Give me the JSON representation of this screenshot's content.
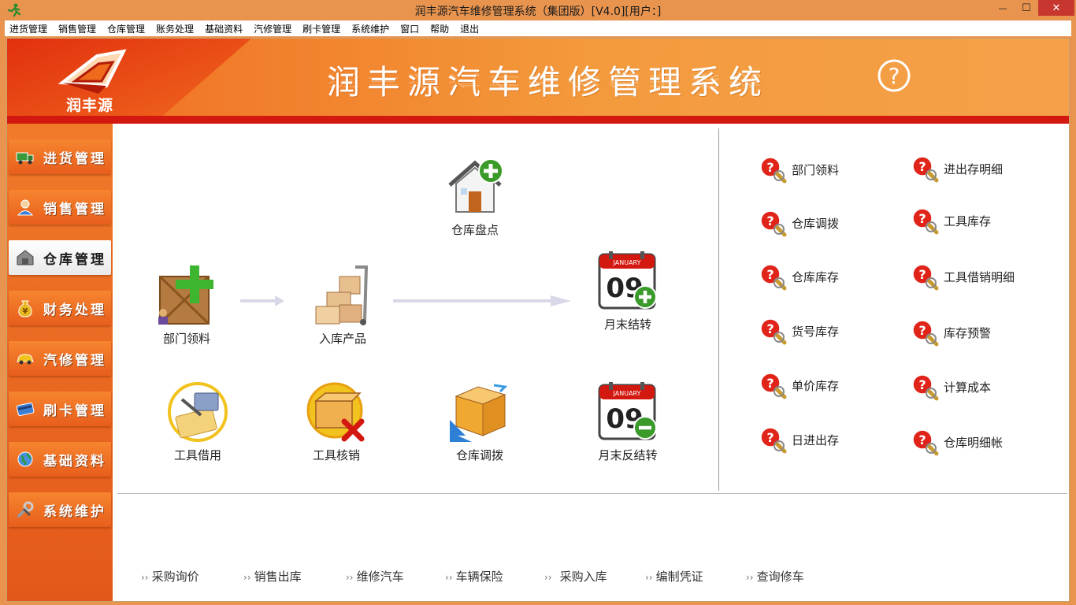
{
  "window": {
    "title": "润丰源汽车维修管理系统（集团版）[V4.0][用户：]",
    "minimize_glyph": "—",
    "maximize_glyph": "☐",
    "close_glyph": "✕"
  },
  "menubar": {
    "items": [
      "进货管理",
      "销售管理",
      "仓库管理",
      "账务处理",
      "基础资料",
      "汽修管理",
      "刷卡管理",
      "系统维护",
      "窗口",
      "帮助",
      "退出"
    ]
  },
  "banner": {
    "logo_text": "润丰源",
    "title": "润丰源汽车维修管理系统",
    "help_glyph": "?"
  },
  "leftnav": {
    "items": [
      {
        "label": "进货管理",
        "icon": "truck-icon"
      },
      {
        "label": "销售管理",
        "icon": "sales-person-icon"
      },
      {
        "label": "仓库管理",
        "icon": "warehouse-icon"
      },
      {
        "label": "财务处理",
        "icon": "money-bag-icon"
      },
      {
        "label": "汽修管理",
        "icon": "car-icon"
      },
      {
        "label": "刷卡管理",
        "icon": "card-icon"
      },
      {
        "label": "基础资料",
        "icon": "globe-icon"
      },
      {
        "label": "系统维护",
        "icon": "tools-icon"
      }
    ],
    "active_index": 2
  },
  "flow": {
    "warehouse_check": "仓库盘点",
    "dept_material": "部门领料",
    "inbound_product": "入库产品",
    "month_close": "月末结转",
    "tool_borrow": "工具借用",
    "tool_writeoff": "工具核销",
    "warehouse_transfer": "仓库调拨",
    "month_reopen": "月末反结转",
    "calendar_month": "JANUARY",
    "calendar_day": "09"
  },
  "queries": {
    "left": [
      "部门领料",
      "仓库调拨",
      "仓库库存",
      "货号库存",
      "单价库存",
      "日进出存"
    ],
    "right": [
      "进出存明细",
      "工具库存",
      "工具借销明细",
      "库存预警",
      "计算成本",
      "仓库明细帐"
    ]
  },
  "quick_links": [
    "采购询价",
    "销售出库",
    "维修汽车",
    "车辆保险",
    "采购入库",
    "编制凭证",
    "查询修车"
  ],
  "quick_link_chevron": "››",
  "colors": {
    "banner_orange": "#F06A1E",
    "banner_red": "#D3180F",
    "nav_orange": "#E85E1C",
    "close_red": "#C7372F"
  }
}
